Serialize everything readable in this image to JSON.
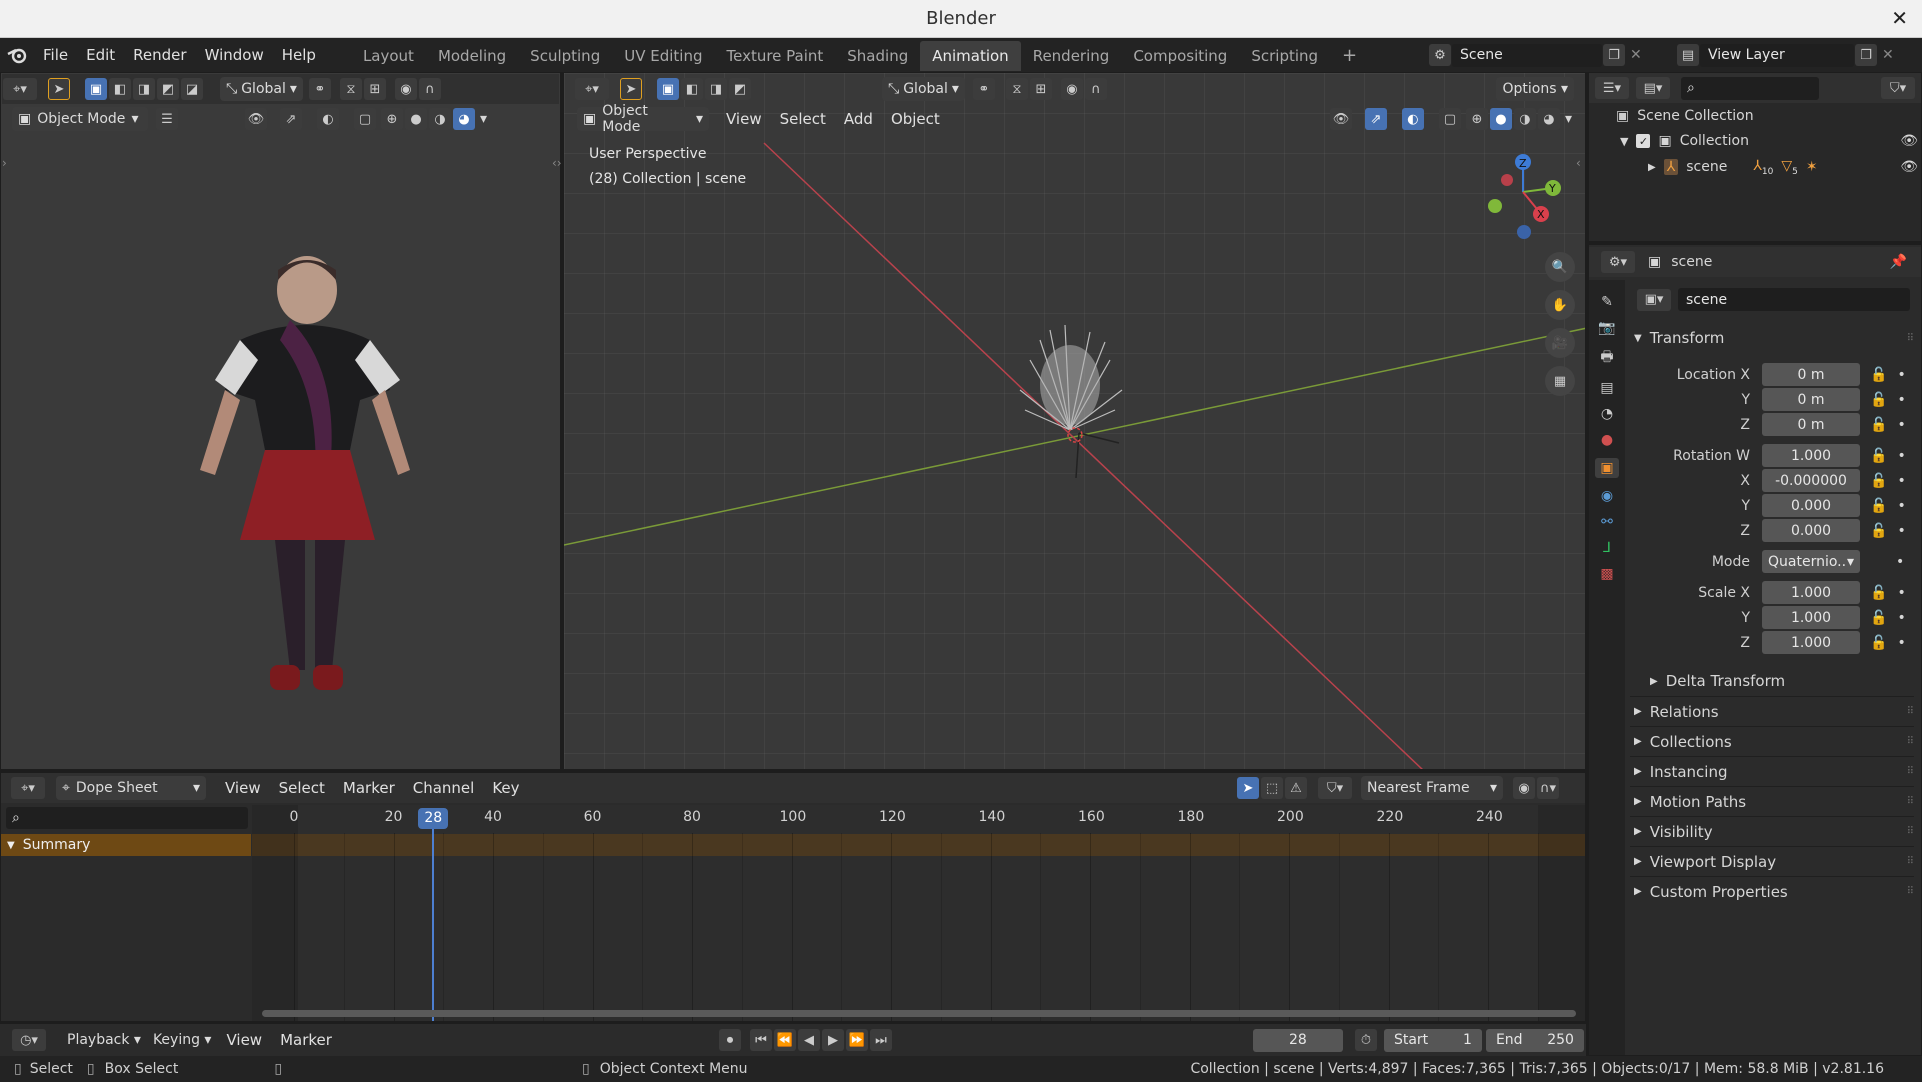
{
  "window": {
    "title": "Blender",
    "close": "✕"
  },
  "menu": [
    "File",
    "Edit",
    "Render",
    "Window",
    "Help"
  ],
  "workspaces": [
    "Layout",
    "Modeling",
    "Sculpting",
    "UV Editing",
    "Texture Paint",
    "Shading",
    "Animation",
    "Rendering",
    "Compositing",
    "Scripting"
  ],
  "workspace_add": "+",
  "scene_name": "Scene",
  "view_layer": "View Layer",
  "left_viewport": {
    "orientation": "Global",
    "mode": "Object Mode"
  },
  "main_viewport": {
    "orientation": "Global",
    "options": "Options",
    "mode": "Object Mode",
    "menus": [
      "View",
      "Select",
      "Add",
      "Object"
    ],
    "overlay_line1": "User Perspective",
    "overlay_line2": "(28) Collection | scene"
  },
  "gizmo": {
    "z": "Z",
    "y": "Y",
    "x": "X"
  },
  "outliner": {
    "root": "Scene Collection",
    "collection": "Collection",
    "object": "scene",
    "badge1": "10",
    "badge2": "5"
  },
  "properties": {
    "object_name": "scene",
    "data_name": "scene",
    "transform": "Transform",
    "loc_x_label": "Location X",
    "y_label": "Y",
    "z_label": "Z",
    "x_label": "X",
    "loc_x": "0 m",
    "loc_y": "0 m",
    "loc_z": "0 m",
    "rot_w_label": "Rotation W",
    "rot_w": "1.000",
    "rot_x": "-0.000000",
    "rot_y": "0.000",
    "rot_z": "0.000",
    "mode_label": "Mode",
    "mode": "Quaternio..",
    "scale_x_label": "Scale X",
    "scale_x": "1.000",
    "scale_y": "1.000",
    "scale_z": "1.000",
    "delta": "Delta Transform",
    "panels": [
      "Relations",
      "Collections",
      "Instancing",
      "Motion Paths",
      "Visibility",
      "Viewport Display",
      "Custom Properties"
    ]
  },
  "dopesheet": {
    "editor": "Dope Sheet",
    "menus": [
      "View",
      "Select",
      "Marker",
      "Channel",
      "Key"
    ],
    "snap": "Nearest Frame",
    "summary": "Summary",
    "ticks": [
      "0",
      "20",
      "40",
      "60",
      "80",
      "100",
      "120",
      "140",
      "160",
      "180",
      "200",
      "220",
      "240"
    ],
    "current_frame": "28"
  },
  "timeline": {
    "playback": "Playback",
    "keying": "Keying",
    "view": "View",
    "marker": "Marker",
    "frame": "28",
    "start_label": "Start",
    "start": "1",
    "end_label": "End",
    "end": "250"
  },
  "status": {
    "select": "Select",
    "box_select": "Box Select",
    "context": "Object Context Menu",
    "stats": "Collection | scene | Verts:4,897 | Faces:7,365 | Tris:7,365 | Objects:0/17 | Mem: 58.8 MiB | v2.81.16"
  }
}
